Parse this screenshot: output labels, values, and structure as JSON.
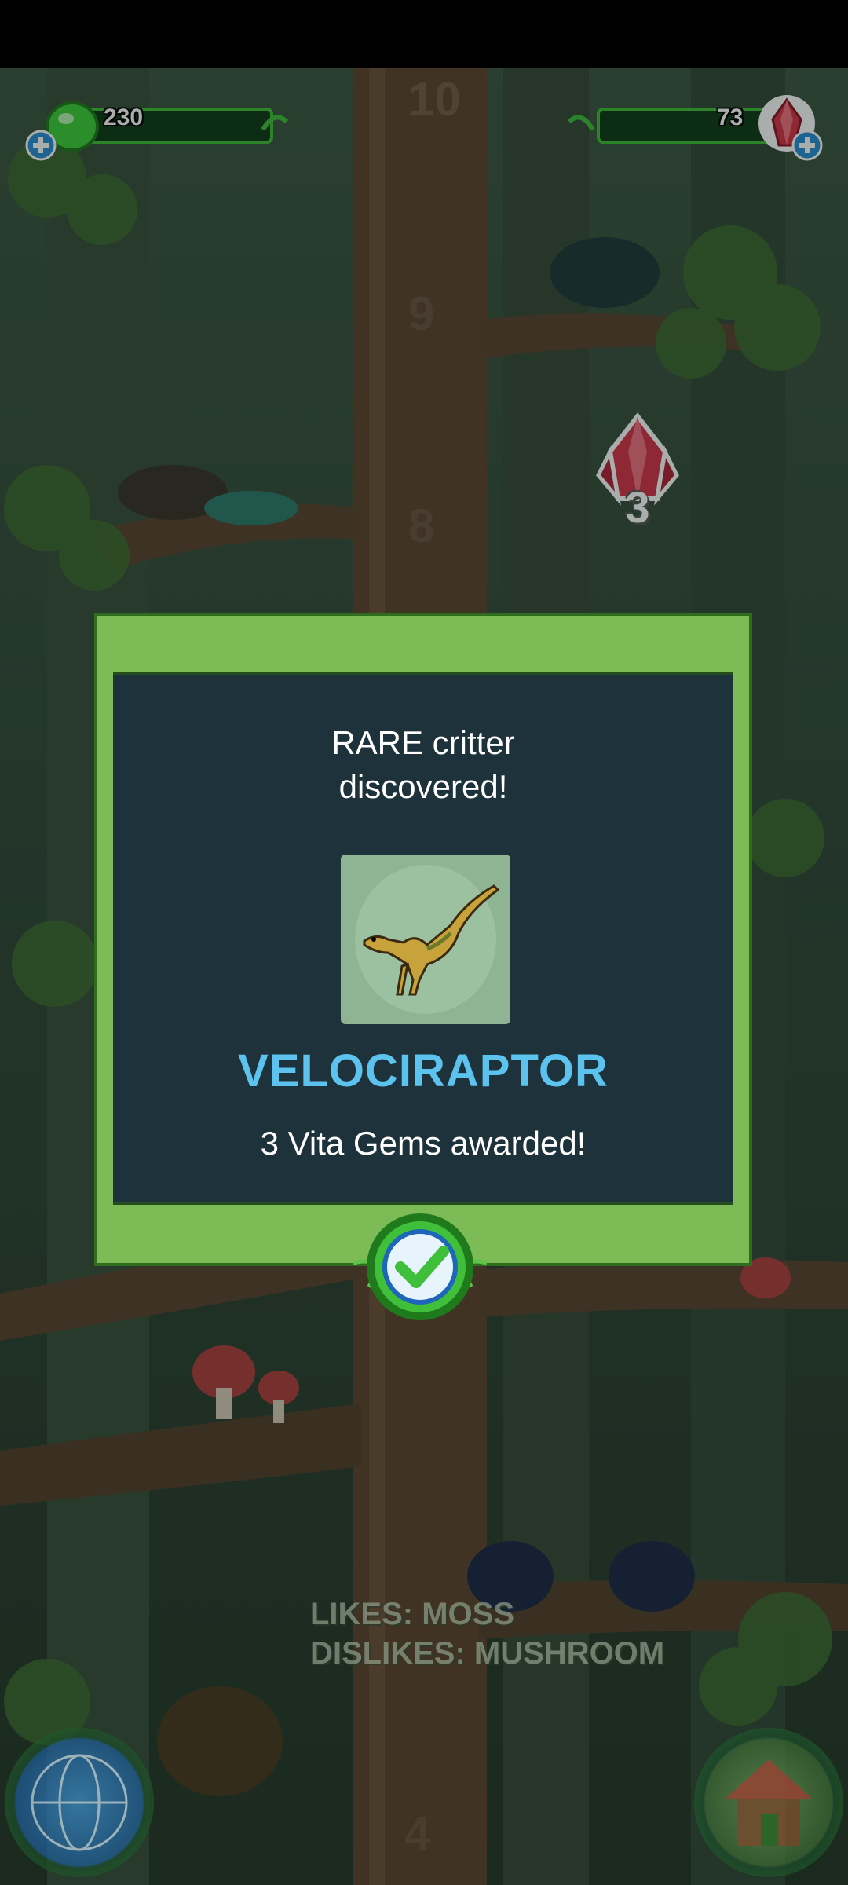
{
  "hud": {
    "green_currency": "230",
    "gem_currency": "73"
  },
  "floating_reward": "3",
  "tree_level_markers": [
    "10",
    "9",
    "8",
    "4"
  ],
  "dialog": {
    "title_line1": "RARE critter",
    "title_line2": "discovered!",
    "critter_name": "VELOCIRAPTOR",
    "award_text": "3 Vita Gems awarded!"
  },
  "critter_info": {
    "likes": "LIKES: MOSS",
    "dislikes": "DISLIKES: MUSHROOM"
  },
  "colors": {
    "dialog_green": "#7dbb56",
    "dialog_panel": "#1d323a",
    "critter_name": "#5cc3ee"
  }
}
